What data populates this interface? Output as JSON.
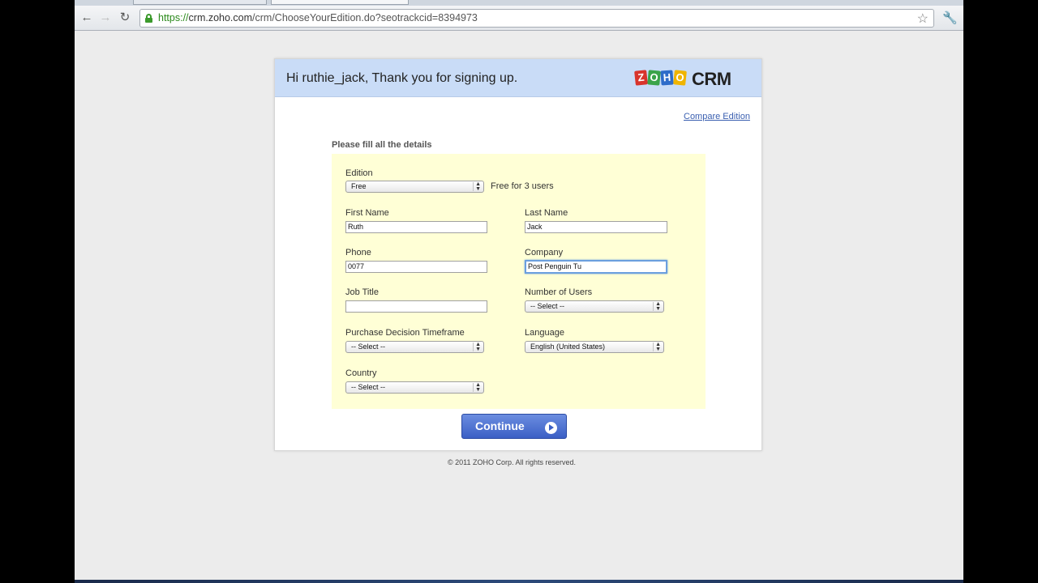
{
  "browser": {
    "url_scheme": "https://",
    "url_host": "crm.zoho.com",
    "url_path": "/crm/ChooseYourEdition.do?seotrackcid=8394973"
  },
  "header": {
    "greeting": "Hi ruthie_jack, Thank you for signing up.",
    "logo_tiles": [
      "Z",
      "O",
      "H",
      "O"
    ],
    "logo_crm": "CRM"
  },
  "links": {
    "compare": "Compare Edition"
  },
  "form": {
    "title": "Please fill all the details",
    "edition": {
      "label": "Edition",
      "value": "Free",
      "hint": "Free for 3 users"
    },
    "first_name": {
      "label": "First Name",
      "value": "Ruth"
    },
    "last_name": {
      "label": "Last Name",
      "value": "Jack"
    },
    "phone": {
      "label": "Phone",
      "value": "0077"
    },
    "company": {
      "label": "Company",
      "value": "Post Penguin Tu"
    },
    "job_title": {
      "label": "Job Title",
      "value": ""
    },
    "num_users": {
      "label": "Number of Users",
      "value": "-- Select --"
    },
    "timeframe": {
      "label": "Purchase Decision Timeframe",
      "value": "-- Select --"
    },
    "language": {
      "label": "Language",
      "value": "English (United States)"
    },
    "country": {
      "label": "Country",
      "value": "-- Select --"
    },
    "continue_label": "Continue"
  },
  "footer": {
    "copyright": "© 2011 ZOHO Corp. All rights reserved."
  },
  "colors": {
    "header_bg": "#c9dcf7",
    "form_bg": "#ffffd6",
    "button": "#3b5fc5",
    "logo_tiles": [
      "#d8342c",
      "#3aa34a",
      "#2e6cc9",
      "#f0b400"
    ]
  }
}
